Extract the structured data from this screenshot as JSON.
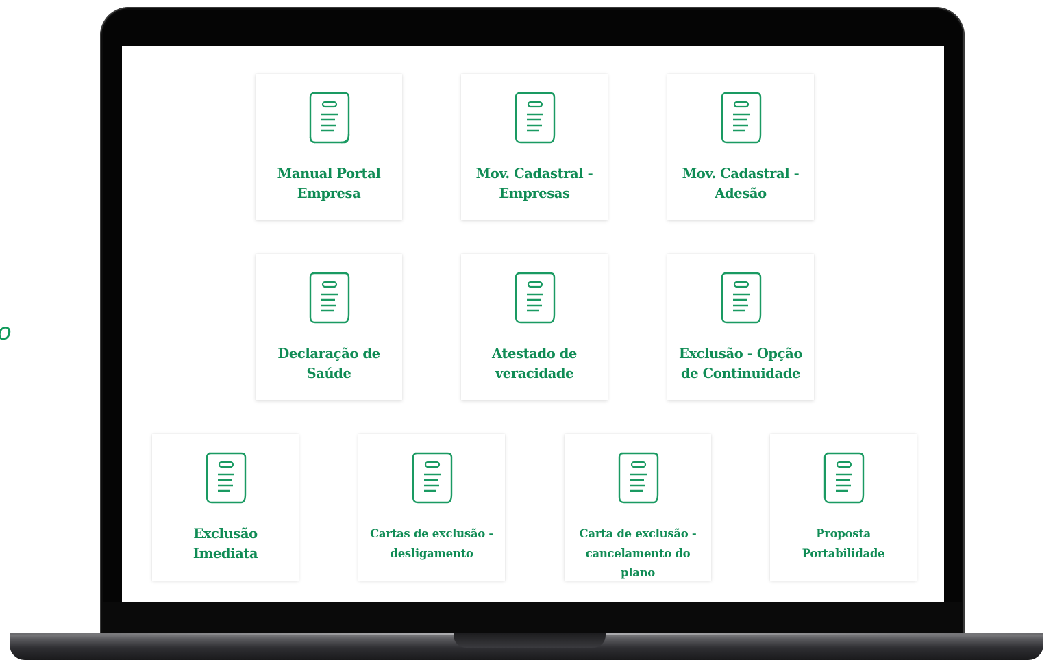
{
  "colors": {
    "accent": "#108c55",
    "icon": "#1a9a62"
  },
  "edge_text": "o",
  "cards": [
    {
      "label": "Manual Portal Empresa",
      "icon": "document-icon"
    },
    {
      "label": "Mov. Cadastral - Empresas",
      "icon": "document-icon"
    },
    {
      "label": "Mov. Cadastral - Adesão",
      "icon": "document-icon"
    },
    {
      "label": "Declaração de Saúde",
      "icon": "document-icon"
    },
    {
      "label": "Atestado de veracidade",
      "icon": "document-icon"
    },
    {
      "label": "Exclusão - Opção de Continuidade",
      "icon": "document-icon"
    },
    {
      "label": "Exclusão Imediata",
      "icon": "document-icon"
    },
    {
      "label": "Cartas de exclusão - desligamento",
      "icon": "document-icon"
    },
    {
      "label": "Carta de exclusão - cancelamento do plano",
      "icon": "document-icon"
    },
    {
      "label": "Proposta Portabilidade",
      "icon": "document-icon"
    }
  ]
}
